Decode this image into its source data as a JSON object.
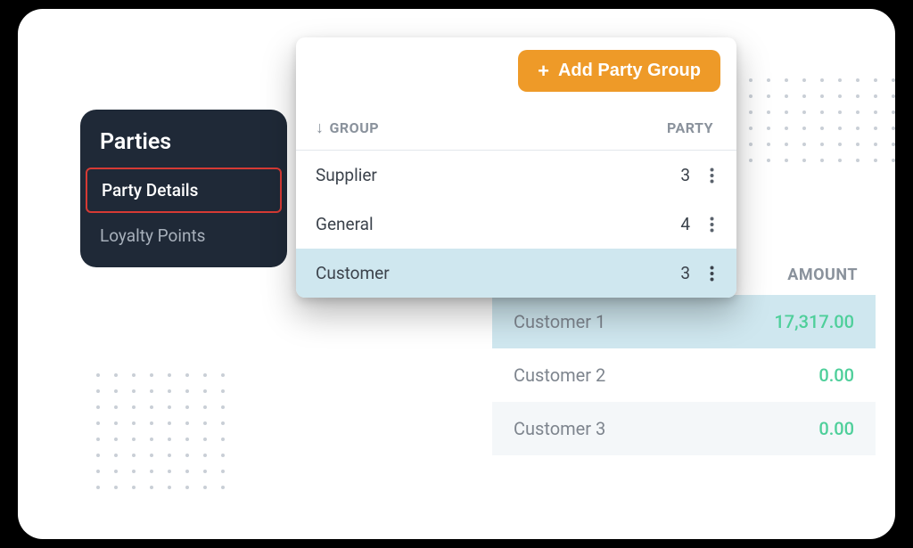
{
  "sidebar": {
    "title": "Parties",
    "items": [
      {
        "label": "Party Details",
        "active": true
      },
      {
        "label": "Loyalty Points",
        "active": false
      }
    ]
  },
  "groups_panel": {
    "add_button_label": "Add Party Group",
    "columns": {
      "group": "GROUP",
      "party": "PARTY"
    },
    "rows": [
      {
        "name": "Supplier",
        "count": "3",
        "selected": false
      },
      {
        "name": "General",
        "count": "4",
        "selected": false
      },
      {
        "name": "Customer",
        "count": "3",
        "selected": true
      }
    ]
  },
  "customer_table": {
    "header_amount": "AMOUNT",
    "rows": [
      {
        "name": "Customer 1",
        "amount": "17,317.00",
        "selected": true
      },
      {
        "name": "Customer 2",
        "amount": "0.00",
        "selected": false
      },
      {
        "name": "Customer 3",
        "amount": "0.00",
        "selected": false
      }
    ]
  }
}
